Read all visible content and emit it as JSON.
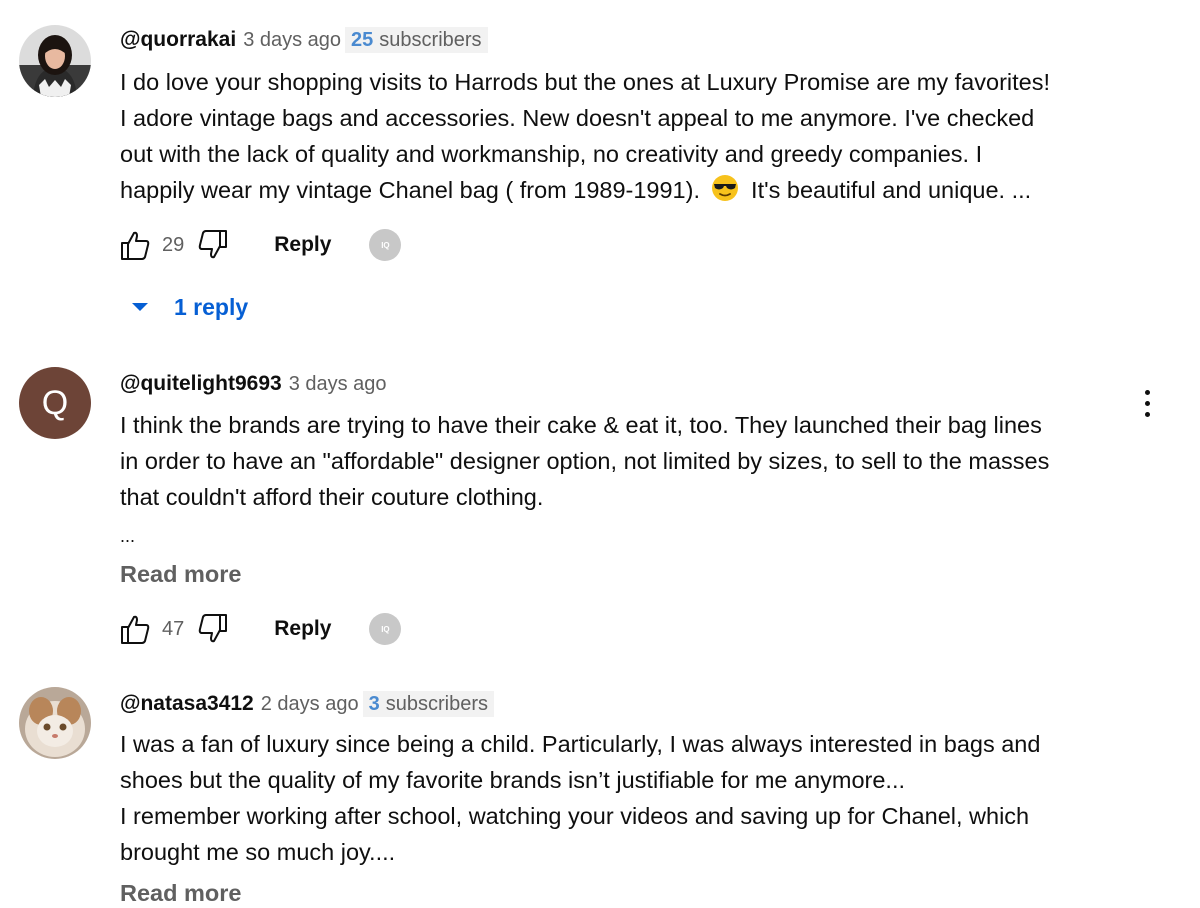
{
  "comments": [
    {
      "author": "@quorrakai",
      "time": "3 days ago",
      "badge_count": "25",
      "badge_label": "subscribers",
      "lines": [
        "I do love your shopping visits to Harrods but the ones at Luxury Promise are my favorites!",
        "I adore vintage bags and accessories. New doesn't appeal to me anymore. I've checked",
        "out with the lack of quality and workmanship, no creativity and greedy companies.  I",
        "happily wear my vintage Chanel bag ( from 1989-1991).",
        "It's beautiful and unique. ..."
      ],
      "likes": "29",
      "reply_label": "Reply",
      "replies_label": "1 reply",
      "ext_label": "IQ"
    },
    {
      "author": "@quitelight9693",
      "time": "3 days ago",
      "avatar_letter": "Q",
      "lines": [
        "I think the brands are trying to have their cake & eat it, too.  They launched their bag lines",
        "in order to have an \"affordable\" designer option, not limited by sizes, to sell to the masses",
        "that couldn't afford their couture clothing."
      ],
      "ellipsis": "...",
      "read_more": "Read more",
      "likes": "47",
      "reply_label": "Reply",
      "ext_label": "IQ"
    },
    {
      "author": "@natasa3412",
      "time": "2 days ago",
      "badge_count": "3",
      "badge_label": "subscribers",
      "lines": [
        "I was a fan of luxury since being a child. Particularly, I was always interested in bags and",
        "shoes but the quality of my favorite brands isn’t justifiable for me anymore...",
        "I remember working after school, watching your videos and saving up for Chanel, which",
        "brought me so much joy...."
      ],
      "read_more": "Read more"
    }
  ],
  "icons": {
    "like": "thumbs-up-icon",
    "dislike": "thumbs-down-icon",
    "expand": "caret-down-icon",
    "more": "more-vert-icon",
    "emoji": "sunglasses-emoji"
  },
  "colors": {
    "link_blue": "#065fd4",
    "secondary_text": "#606060",
    "badge_bg": "#f2f2f2",
    "badge_number": "#4a8ad0",
    "avatar_q_bg": "#6d4437"
  }
}
